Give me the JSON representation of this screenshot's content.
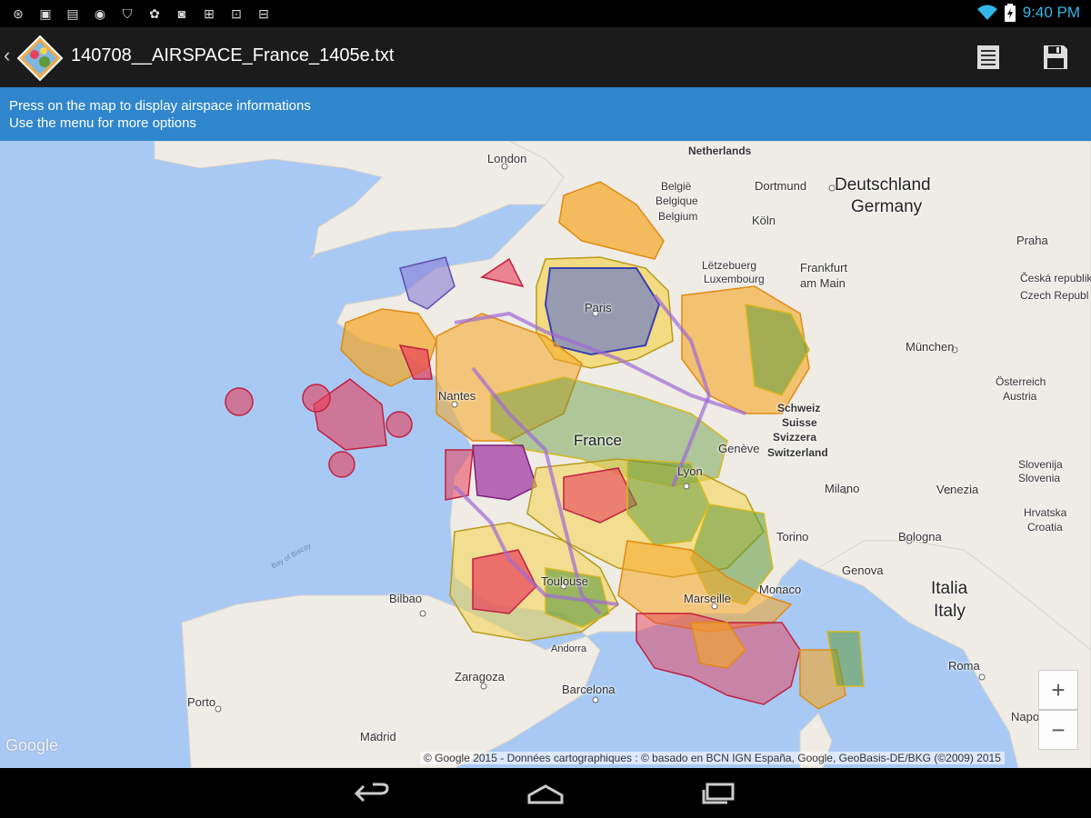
{
  "status_bar": {
    "icons": [
      "usb-icon",
      "image-icon",
      "sim-icon",
      "app-icon",
      "shield-icon",
      "game-icon",
      "photo-icon",
      "gamepad-icon",
      "bag-icon",
      "download-icon"
    ],
    "time": "9:40 PM"
  },
  "action_bar": {
    "title": "140708__AIRSPACE_France_1405e.txt",
    "menu_icon": "list-icon",
    "save_icon": "save-icon"
  },
  "info_bar": {
    "line1": "Press on the map to display airspace informations",
    "line2": "Use the menu for more options"
  },
  "map": {
    "labels": {
      "london": "London",
      "netherlands": "Netherlands",
      "belgie": "België",
      "belgique": "Belgique",
      "belgium": "Belgium",
      "dortmund": "Dortmund",
      "deutschland": "Deutschland",
      "germany": "Germany",
      "koln": "Köln",
      "luxembourg1": "Lëtzebuerg",
      "luxembourg2": "Luxembourg",
      "frankfurt1": "Frankfurt",
      "frankfurt2": "am Main",
      "praha": "Praha",
      "ceska1": "Česká republik",
      "ceska2": "Czech Republ",
      "paris": "Paris",
      "munchen": "München",
      "osterreich": "Österreich",
      "austria": "Austria",
      "nantes": "Nantes",
      "france": "France",
      "schweiz": "Schweiz",
      "suisse": "Suisse",
      "svizzera": "Svizzera",
      "switzerland": "Switzerland",
      "geneve": "Genève",
      "lyon": "Lyon",
      "slovenija": "Slovenija",
      "slovenia": "Slovenia",
      "milano": "Milano",
      "venezia": "Venezia",
      "hrvatska": "Hrvatska",
      "croatia": "Croatia",
      "torino": "Torino",
      "bologna": "Bologna",
      "bay_of_biscay": "Bay of Biscay",
      "toulouse": "Toulouse",
      "genova": "Genova",
      "bilbao": "Bilbao",
      "marseille": "Marseille",
      "monaco": "Monaco",
      "italia": "Italia",
      "italy": "Italy",
      "andorra": "Andorra",
      "zaragoza": "Zaragoza",
      "barcelona": "Barcelona",
      "roma": "Roma",
      "porto": "Porto",
      "madrid": "Madrid",
      "napoli": "Napo"
    },
    "zoom_in": "+",
    "zoom_out": "−",
    "google_logo": "Google",
    "attribution": "© Google 2015 - Données cartographiques : © basado en BCN IGN España, Google, GeoBasis-DE/BKG (©2009) 2015"
  },
  "nav_bar": {
    "back_icon": "back-icon",
    "home_icon": "home-icon",
    "recents_icon": "recents-icon"
  },
  "colors": {
    "water": "#a9c9f5",
    "land": "#efece6",
    "info_bar": "#2f86cc",
    "airspace_red": "#e8405a",
    "airspace_orange": "#f5a623",
    "airspace_yellow": "#f3d34a",
    "airspace_green": "#5f9a3a",
    "airspace_blue": "#5a6fd0",
    "airspace_purple": "#a06ad6"
  }
}
